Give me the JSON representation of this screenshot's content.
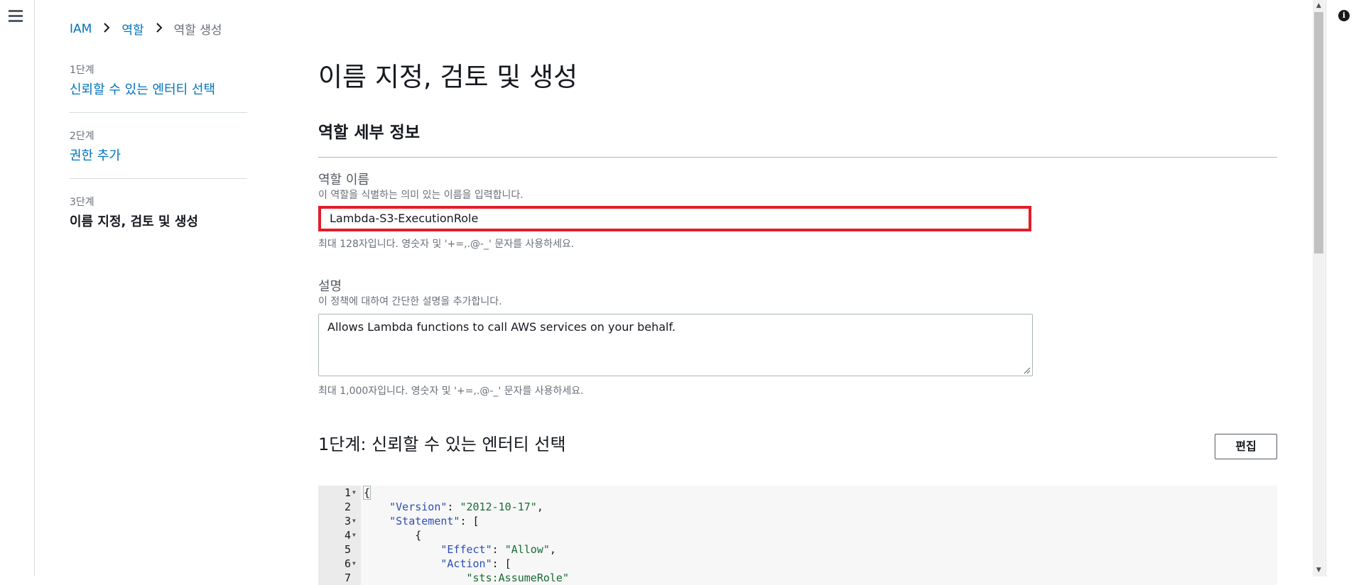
{
  "breadcrumb": {
    "items": [
      "IAM",
      "역할"
    ],
    "current": "역할 생성"
  },
  "steps": [
    {
      "number": "1단계",
      "label": "신뢰할 수 있는 엔터티 선택"
    },
    {
      "number": "2단계",
      "label": "권한 추가"
    },
    {
      "number": "3단계",
      "label": "이름 지정, 검토 및 생성"
    }
  ],
  "main": {
    "title": "이름 지정, 검토 및 생성",
    "section_title": "역할 세부 정보",
    "role_name": {
      "label": "역할 이름",
      "description": "이 역할을 식별하는 의미 있는 이름을 입력합니다.",
      "value": "Lambda-S3-ExecutionRole",
      "hint": "최대 128자입니다. 영숫자 및 '+=,.@-_' 문자를 사용하세요."
    },
    "description_field": {
      "label": "설명",
      "description": "이 정책에 대하여 간단한 설명을 추가합니다.",
      "value": "Allows Lambda functions to call AWS services on your behalf.",
      "hint": "최대 1,000자입니다. 영숫자 및 '+=,.@-_' 문자를 사용하세요."
    },
    "step1_section": {
      "title": "1단계: 신뢰할 수 있는 엔터티 선택",
      "edit_button": "편집"
    }
  },
  "policy_code": [
    {
      "n": "1",
      "fold": true,
      "text": "{"
    },
    {
      "n": "2",
      "fold": false,
      "text": "    \"Version\": \"2012-10-17\","
    },
    {
      "n": "3",
      "fold": true,
      "text": "    \"Statement\": ["
    },
    {
      "n": "4",
      "fold": true,
      "text": "        {"
    },
    {
      "n": "5",
      "fold": false,
      "text": "            \"Effect\": \"Allow\","
    },
    {
      "n": "6",
      "fold": true,
      "text": "            \"Action\": ["
    },
    {
      "n": "7",
      "fold": false,
      "text": "                \"sts:AssumeRole\""
    }
  ],
  "icons": {
    "menu": "hamburger-menu-icon",
    "info": "info-icon",
    "breadcrumb_separator": "chevron-right-icon"
  },
  "colors": {
    "link": "#0073bb",
    "highlight_border": "#e11d2a",
    "json_key": "#2c4eb7",
    "json_string": "#1a6b35"
  }
}
